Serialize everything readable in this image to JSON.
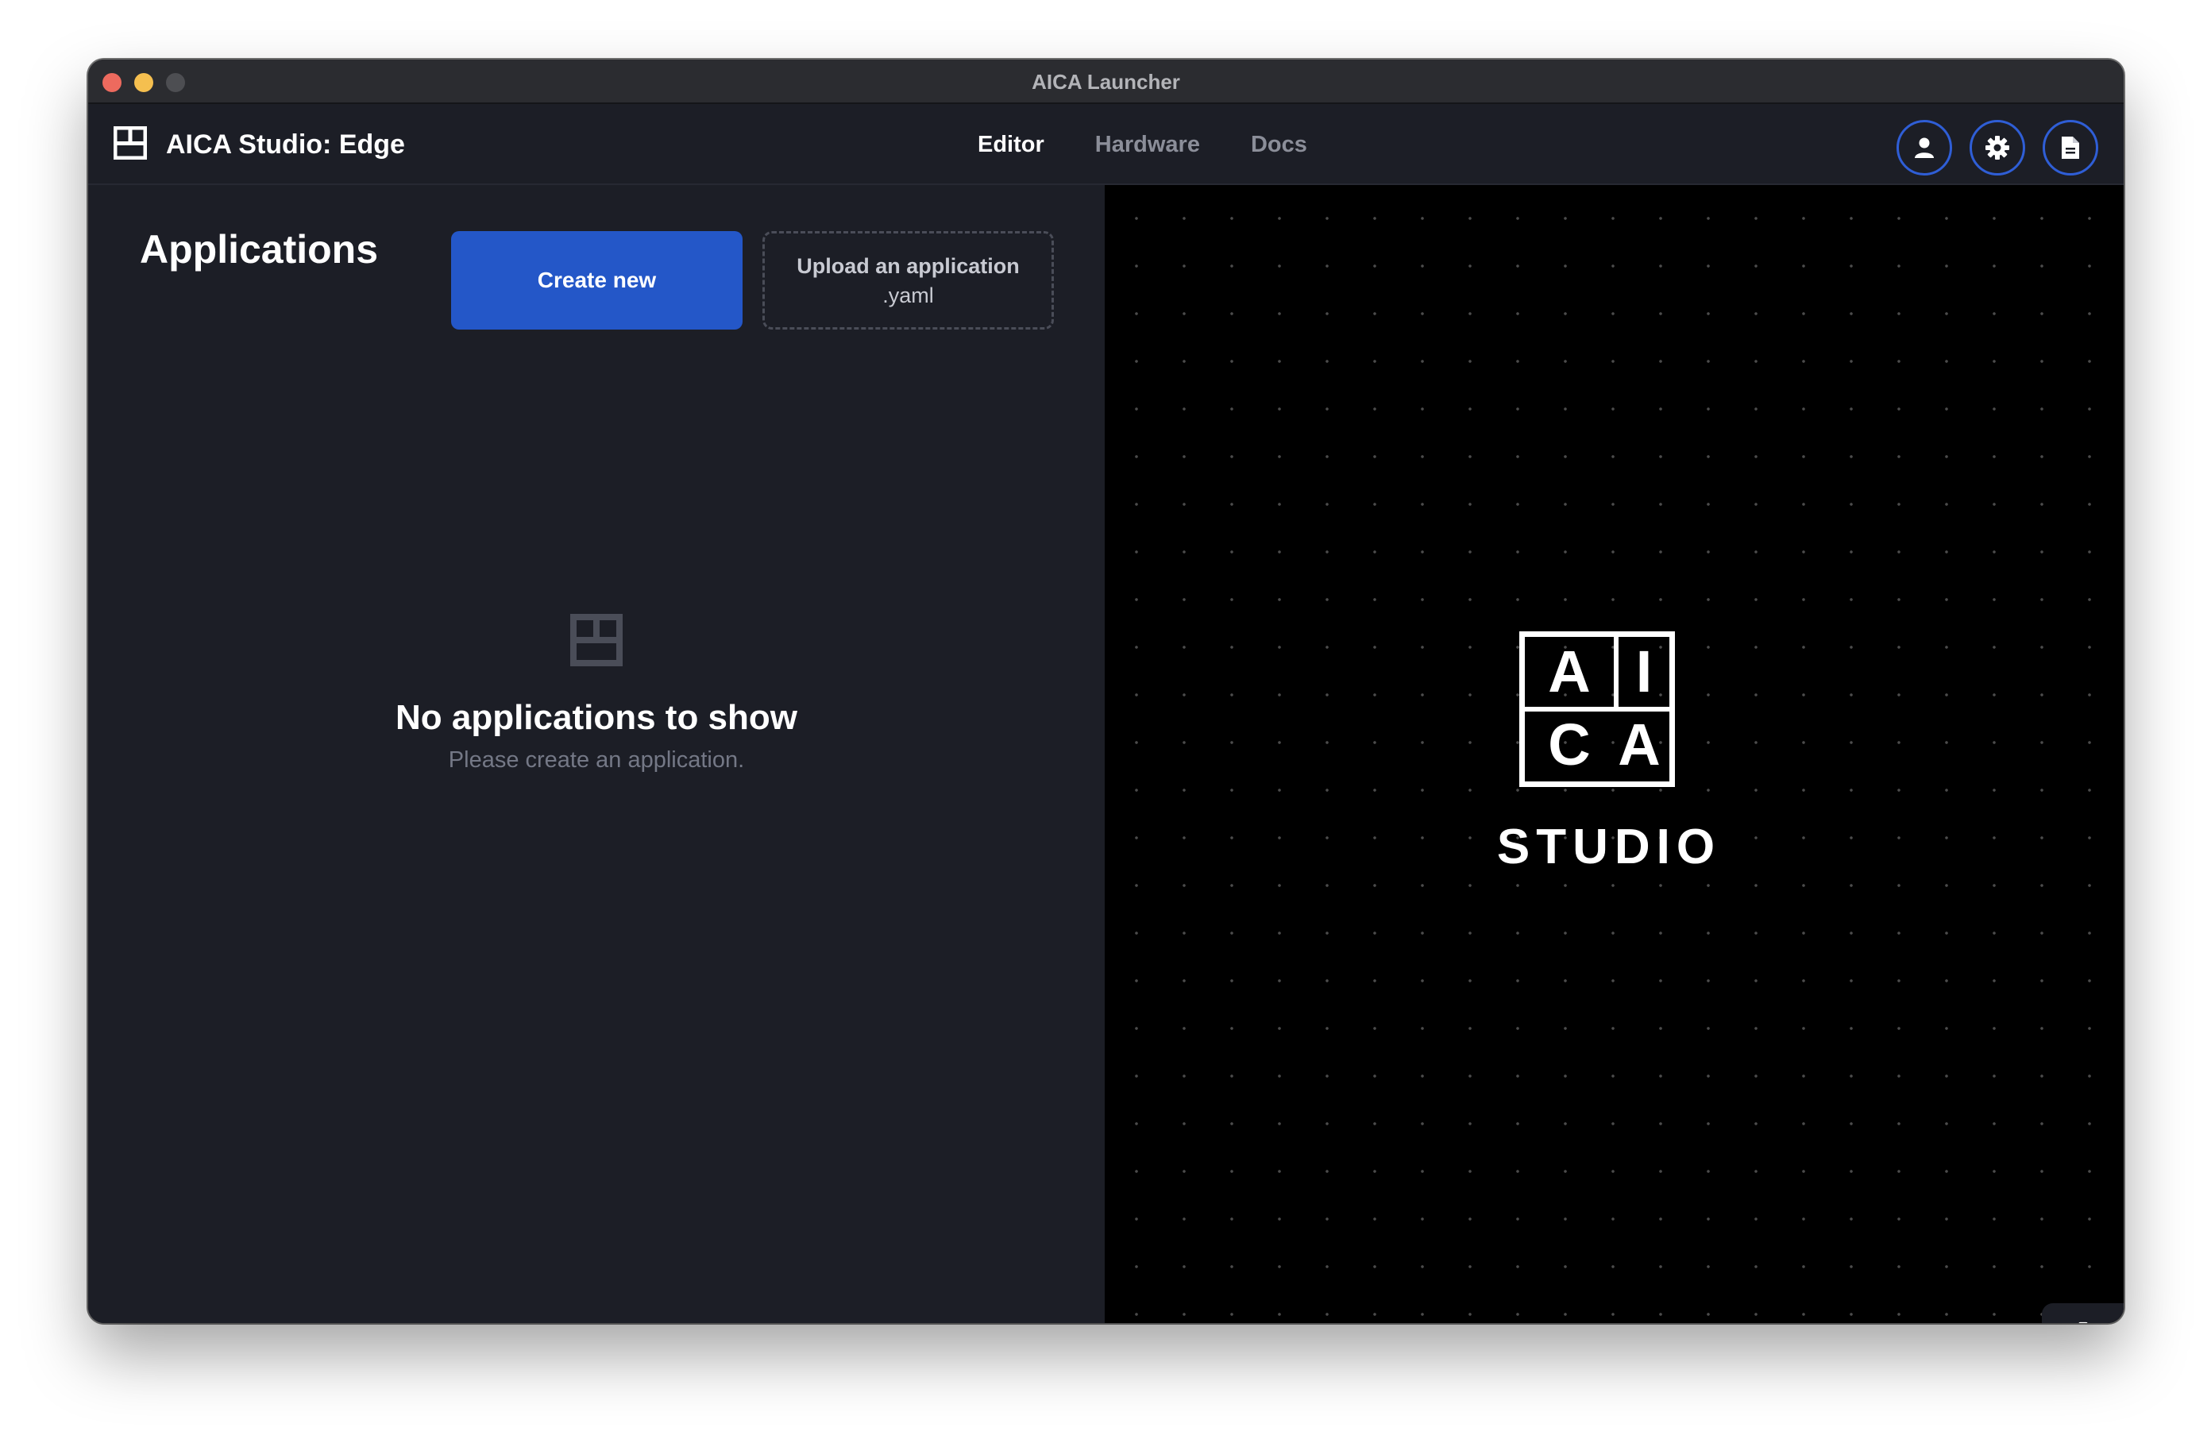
{
  "window": {
    "title": "AICA Launcher"
  },
  "header": {
    "app_title": "AICA Studio: Edge",
    "nav": [
      {
        "label": "Editor",
        "active": true
      },
      {
        "label": "Hardware",
        "active": false
      },
      {
        "label": "Docs",
        "active": false
      }
    ],
    "icons": [
      "user-icon",
      "gear-icon",
      "document-icon"
    ]
  },
  "applications": {
    "heading": "Applications",
    "create_label": "Create new",
    "upload_label": "Upload an application",
    "upload_ext": ".yaml",
    "empty_title": "No applications to show",
    "empty_subtitle": "Please create an application."
  },
  "brand": {
    "logo_letters": [
      "A",
      "I",
      "C",
      "A"
    ],
    "word": "STUDIO"
  },
  "colors": {
    "accent": "#2457c8",
    "background": "#1c1e26",
    "canvas": "#000000"
  }
}
